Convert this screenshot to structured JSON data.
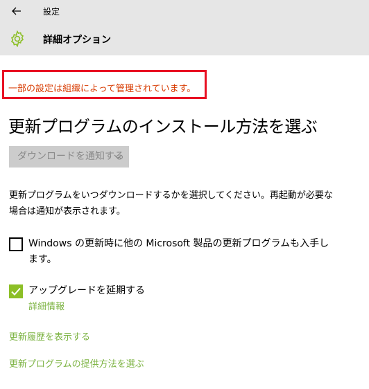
{
  "header": {
    "app_title": "設定",
    "page_title": "詳細オプション",
    "accent_color": "#8cbf26"
  },
  "notice": {
    "text": "一部の設定は組織によって管理されています。",
    "color": "#d83b01"
  },
  "main": {
    "heading": "更新プログラムのインストール方法を選ぶ",
    "dropdown": {
      "selected": "ダウンロードを通知する",
      "disabled": true
    },
    "description": "更新プログラムをいつダウンロードするかを選択してください。再起動が必要な場合は通知が表示されます。",
    "checkboxes": [
      {
        "label": "Windows の更新時に他の Microsoft 製品の更新プログラムも入手します。",
        "checked": false
      },
      {
        "label": "アップグレードを延期する",
        "checked": true
      }
    ],
    "details_link": "詳細情報",
    "links": [
      "更新履歴を表示する",
      "更新プログラムの提供方法を選ぶ"
    ]
  }
}
